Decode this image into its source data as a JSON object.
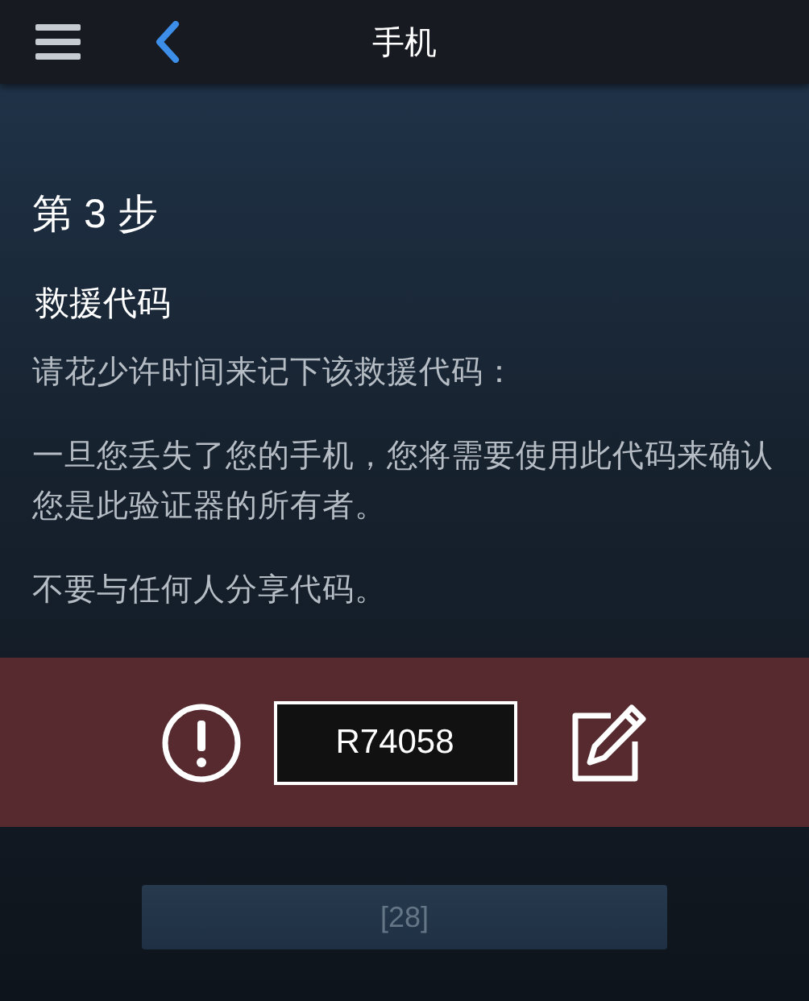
{
  "header": {
    "title": "手机"
  },
  "step_title": "第 3 步",
  "section_title": "救援代码",
  "paragraphs": [
    "请花少许时间来记下该救援代码：",
    "一旦您丢失了您的手机，您将需要使用此代码来确认您是此验证器的所有者。",
    "不要与任何人分享代码。"
  ],
  "code": "R74058",
  "countdown_button": {
    "label": "[28]",
    "disabled": true
  }
}
